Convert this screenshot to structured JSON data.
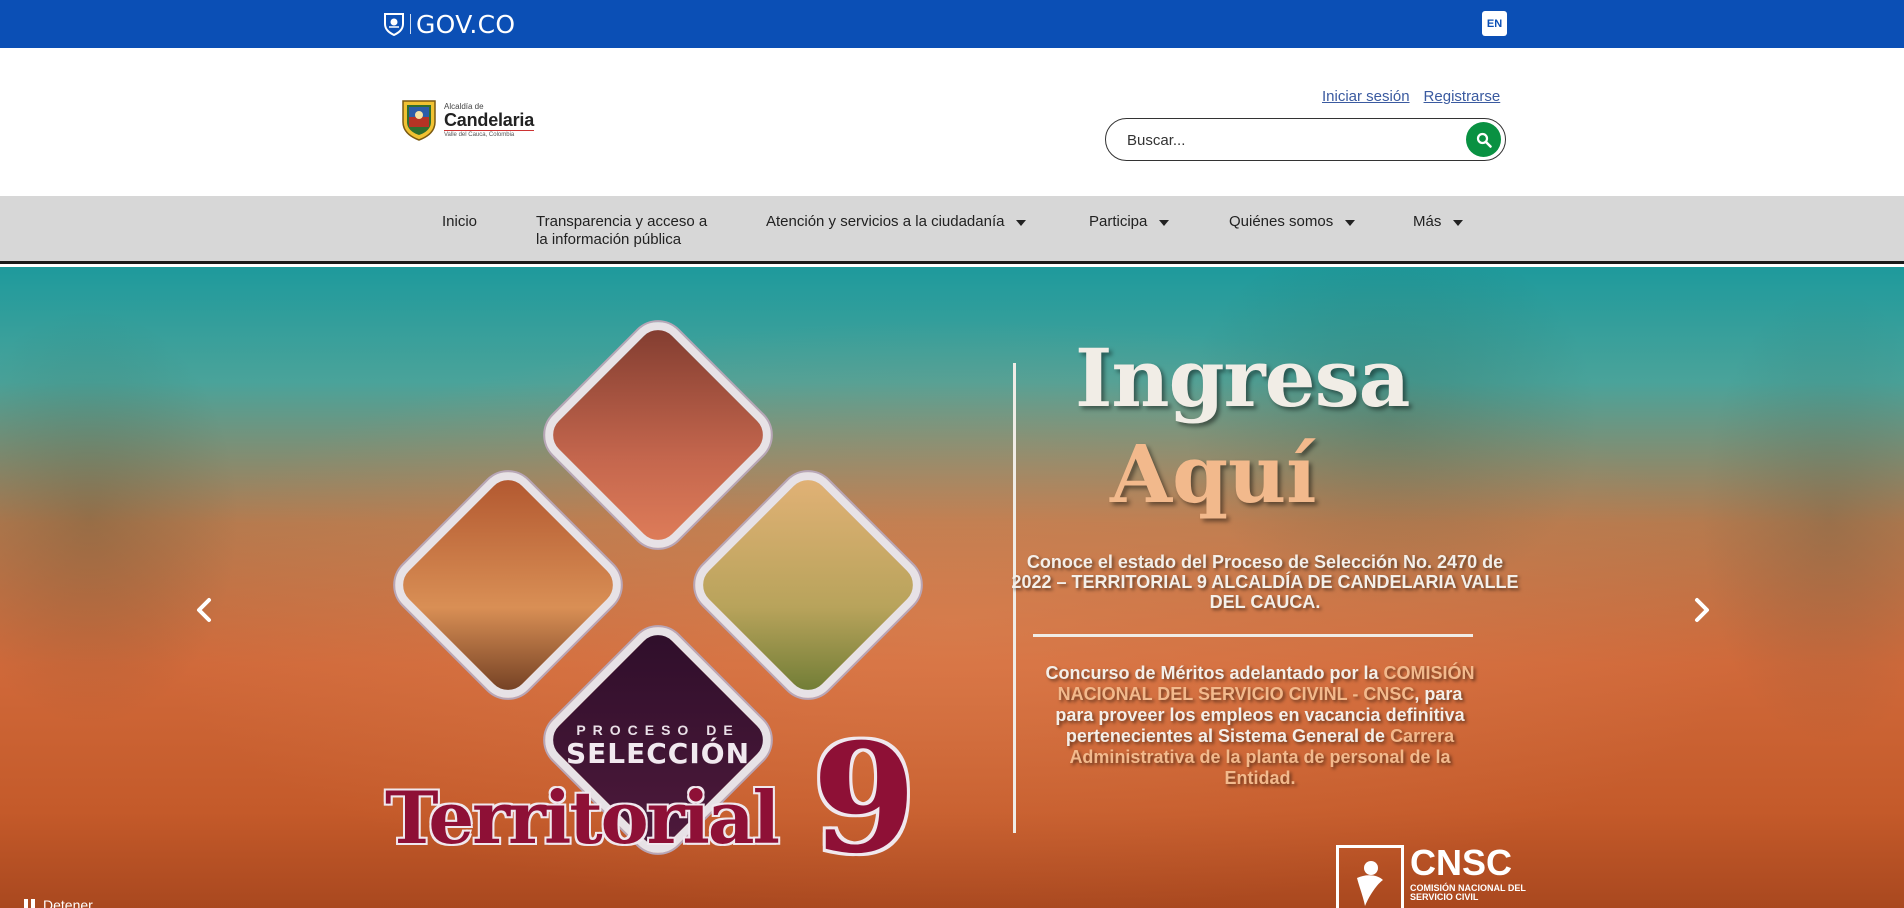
{
  "govbar": {
    "brand": "GOV.CO",
    "language_button": "EN",
    "bg_color": "#0b4fb5"
  },
  "header": {
    "logo": {
      "line1": "Alcaldía de",
      "line2": "Candelaria",
      "line3": "Valle del Cauca, Colombia"
    },
    "login_link": "Iniciar sesión",
    "register_link": "Registrarse",
    "search": {
      "placeholder": "Buscar...",
      "value": "",
      "icon": "search-icon",
      "button_color": "#099142"
    }
  },
  "nav": {
    "items": [
      {
        "label": "Inicio",
        "has_dropdown": false
      },
      {
        "label": "Transparencia y acceso a la información pública",
        "has_dropdown": false
      },
      {
        "label": "Atención y servicios a la ciudadanía",
        "has_dropdown": true
      },
      {
        "label": "Participa",
        "has_dropdown": true
      },
      {
        "label": "Quiénes somos",
        "has_dropdown": true
      },
      {
        "label": "Más",
        "has_dropdown": true
      }
    ],
    "bg_color": "#d7d7d7"
  },
  "hero": {
    "slide": {
      "proceso_label": "PROCESO DE",
      "seleccion_label": "SELECCIÓN",
      "territorial_label": "Territorial",
      "territorial_number": "9",
      "headline_1": "Ingresa",
      "headline_2": "Aquí",
      "info_1": "Conoce el estado del Proceso de Selección No. 2470 de 2022 – TERRITORIAL 9 ALCALDÍA DE CANDELARIA VALLE DEL CAUCA.",
      "info_2_part1": "Concurso de Méritos adelantado por la",
      "info_2_highlight": "COMISIÓN NACIONAL DEL SERVICIO CIVINL - CNSC",
      "info_2_part2": ", para para proveer los empleos en vacancia definitiva pertenecientes al Sistema General de",
      "info_2_highlight2": "Carrera Administrativa de la planta de personal de la Entidad.",
      "cnsc_big": "CNSC",
      "cnsc_small": "COMISIÓN NACIONAL DEL SERVICIO CIVIL"
    },
    "prev_icon": "chevron-left-icon",
    "next_icon": "chevron-right-icon",
    "pause_label": "Detener"
  }
}
